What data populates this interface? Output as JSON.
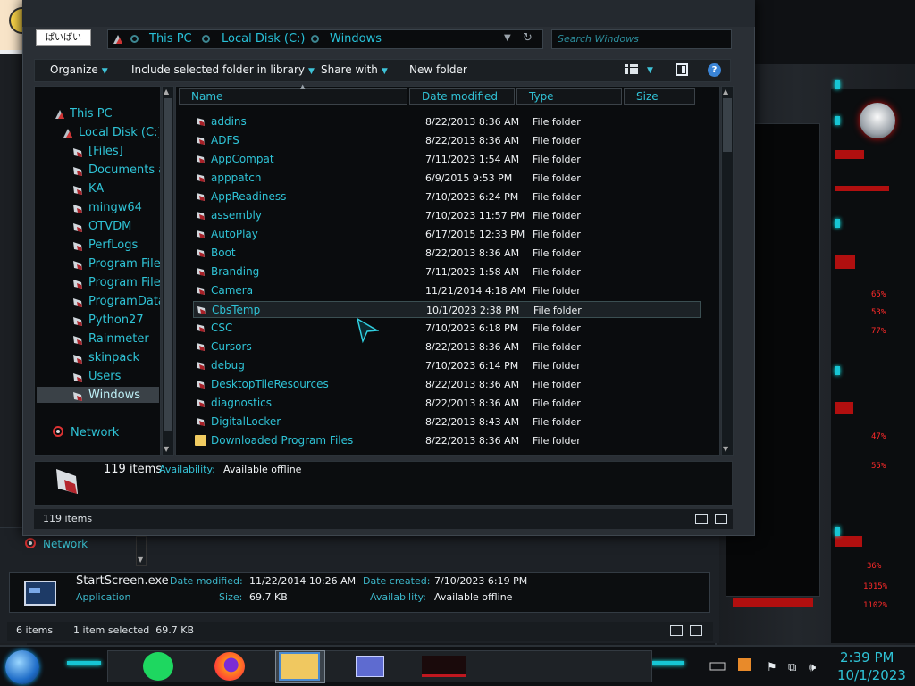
{
  "title_tag": "ぱいぱい",
  "address": {
    "crumbs": [
      "This PC",
      "Local Disk (C:)",
      "Windows"
    ],
    "search_placeholder": "Search Windows"
  },
  "toolbar": {
    "organize": "Organize",
    "include": "Include selected folder in library",
    "share": "Share with",
    "new_folder": "New folder",
    "help": "?"
  },
  "nav": {
    "this_pc": "This PC",
    "local_disk": "Local Disk (C:)",
    "items": [
      "[Files]",
      "Documents ar",
      "KA",
      "mingw64",
      "OTVDM",
      "PerfLogs",
      "Program Files",
      "Program Files",
      "ProgramData",
      "Python27",
      "Rainmeter",
      "skinpack",
      "Users",
      "Windows"
    ],
    "network": "Network"
  },
  "columns": {
    "name": "Name",
    "date": "Date modified",
    "type": "Type",
    "size": "Size"
  },
  "files": [
    {
      "name": "addins",
      "date": "8/22/2013 8:36 AM",
      "type": "File folder"
    },
    {
      "name": "ADFS",
      "date": "8/22/2013 8:36 AM",
      "type": "File folder"
    },
    {
      "name": "AppCompat",
      "date": "7/11/2023 1:54 AM",
      "type": "File folder"
    },
    {
      "name": "apppatch",
      "date": "6/9/2015 9:53 PM",
      "type": "File folder"
    },
    {
      "name": "AppReadiness",
      "date": "7/10/2023 6:24 PM",
      "type": "File folder"
    },
    {
      "name": "assembly",
      "date": "7/10/2023 11:57 PM",
      "type": "File folder"
    },
    {
      "name": "AutoPlay",
      "date": "6/17/2015 12:33 PM",
      "type": "File folder"
    },
    {
      "name": "Boot",
      "date": "8/22/2013 8:36 AM",
      "type": "File folder"
    },
    {
      "name": "Branding",
      "date": "7/11/2023 1:58 AM",
      "type": "File folder"
    },
    {
      "name": "Camera",
      "date": "11/21/2014 4:18 AM",
      "type": "File folder"
    },
    {
      "name": "CbsTemp",
      "date": "10/1/2023 2:38 PM",
      "type": "File folder"
    },
    {
      "name": "CSC",
      "date": "7/10/2023 6:18 PM",
      "type": "File folder"
    },
    {
      "name": "Cursors",
      "date": "8/22/2013 8:36 AM",
      "type": "File folder"
    },
    {
      "name": "debug",
      "date": "7/10/2023 6:14 PM",
      "type": "File folder"
    },
    {
      "name": "DesktopTileResources",
      "date": "8/22/2013 8:36 AM",
      "type": "File folder"
    },
    {
      "name": "diagnostics",
      "date": "8/22/2013 8:36 AM",
      "type": "File folder"
    },
    {
      "name": "DigitalLocker",
      "date": "8/22/2013 8:43 AM",
      "type": "File folder"
    },
    {
      "name": "Downloaded Program Files",
      "date": "8/22/2013 8:36 AM",
      "type": "File folder"
    }
  ],
  "details": {
    "count": "119 items",
    "availability_label": "Availability:",
    "availability_value": "Available offline"
  },
  "status": {
    "count": "119 items"
  },
  "back_window": {
    "network": "Network",
    "file_name": "StartScreen.exe",
    "file_kind": "Application",
    "modified_label": "Date modified:",
    "modified_value": "11/22/2014 10:26 AM",
    "size_label": "Size:",
    "size_value": "69.7 KB",
    "created_label": "Date created:",
    "created_value": "7/10/2023 6:19 PM",
    "availability_label": "Availability:",
    "availability_value": "Available offline",
    "status_count": "6 items",
    "status_selected": "1 item selected  69.7 KB"
  },
  "taskbar": {
    "time": "2:39 PM",
    "date": "10/1/2023",
    "apps": [
      "spotify-icon",
      "firefox-icon",
      "file-explorer-icon",
      "control-panel-icon",
      "alienware-icon"
    ]
  },
  "alien_widget": {
    "readouts": [
      "65%",
      "53%",
      "77%",
      "47%",
      "55%",
      "36%",
      "1015%",
      "1102%"
    ]
  },
  "colors": {
    "accent": "#2fc3d6",
    "window": "#2a2f35",
    "pane": "#0a0c0e",
    "alert": "#ff2a2a"
  }
}
